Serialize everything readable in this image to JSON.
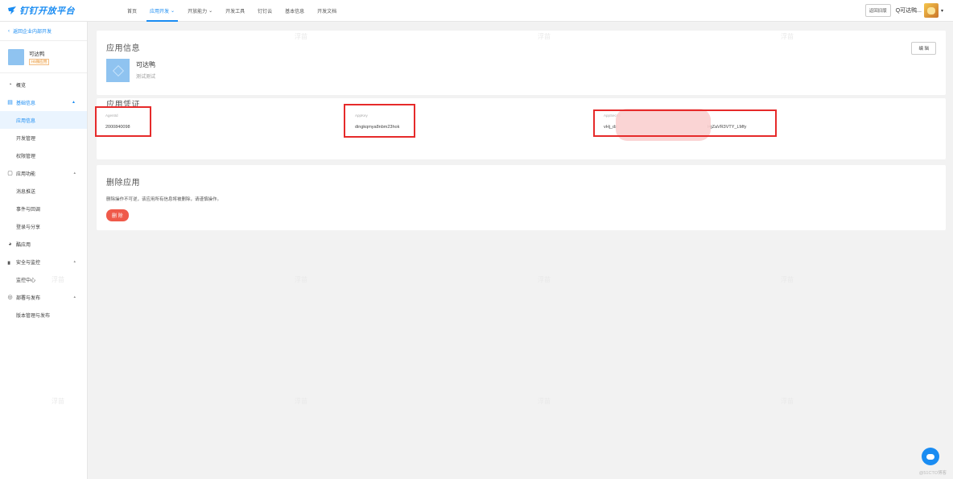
{
  "header": {
    "logo_text": "钉钉开放平台",
    "nav": [
      {
        "label": "首页",
        "active": false,
        "dropdown": false
      },
      {
        "label": "应用开发",
        "active": true,
        "dropdown": true
      },
      {
        "label": "开放能力",
        "active": false,
        "dropdown": true
      },
      {
        "label": "开发工具",
        "active": false,
        "dropdown": false
      },
      {
        "label": "钉钉云",
        "active": false,
        "dropdown": false
      },
      {
        "label": "基本信息",
        "active": false,
        "dropdown": false
      },
      {
        "label": "开发文档",
        "active": false,
        "dropdown": false
      }
    ],
    "back_old_label": "返回旧版",
    "user_name": "Q可达鸭..."
  },
  "sidebar": {
    "back_label": "返回企业内部开发",
    "app_name": "可达鸭",
    "app_badge": "H5微应用",
    "items": [
      {
        "label": "概览",
        "icon": "dashboard-icon"
      },
      {
        "label": "基础信息",
        "icon": "document-icon",
        "expanded": true,
        "children": [
          {
            "label": "应用信息",
            "active": true
          },
          {
            "label": "开发管理",
            "active": false
          },
          {
            "label": "权限管理",
            "active": false
          }
        ]
      },
      {
        "label": "应用功能",
        "icon": "function-icon",
        "expanded": false,
        "children": [
          {
            "label": "消息推送"
          },
          {
            "label": "事件与回调"
          },
          {
            "label": "登录与分享"
          }
        ]
      },
      {
        "label": "酷应用",
        "icon": "cool-app-icon"
      },
      {
        "label": "安全与监控",
        "icon": "chart-icon",
        "expanded": false,
        "children": [
          {
            "label": "监控中心"
          }
        ]
      },
      {
        "label": "部署与发布",
        "icon": "deploy-icon",
        "expanded": false,
        "children": [
          {
            "label": "版本管理与发布"
          }
        ]
      }
    ]
  },
  "app_info": {
    "title": "应用信息",
    "edit_label": "编 辑",
    "name": "可达鸭",
    "description": "测试测试"
  },
  "credentials": {
    "title": "应用凭证",
    "agent_id_label": "AgentId",
    "agent_id_value": "2000840098",
    "app_key_label": "AppKey",
    "app_key_value": "dingkqmya8nbm23hok",
    "app_secret_label": "AppSecret",
    "app_secret_prefix": "vHj_dx",
    "app_secret_suffix": "t4jZaVR3VTY_LMfy"
  },
  "delete": {
    "title": "删除应用",
    "warning": "删除操作不可逆，该应用所有信息将被删除，请谨慎操作。",
    "button_label": "删 除"
  },
  "watermark_text": "浮苗",
  "footer_mark": "@51CTO博客",
  "colors": {
    "brand": "#1a8cf2",
    "danger": "#ef5a4a",
    "highlight": "#e62a2a"
  }
}
